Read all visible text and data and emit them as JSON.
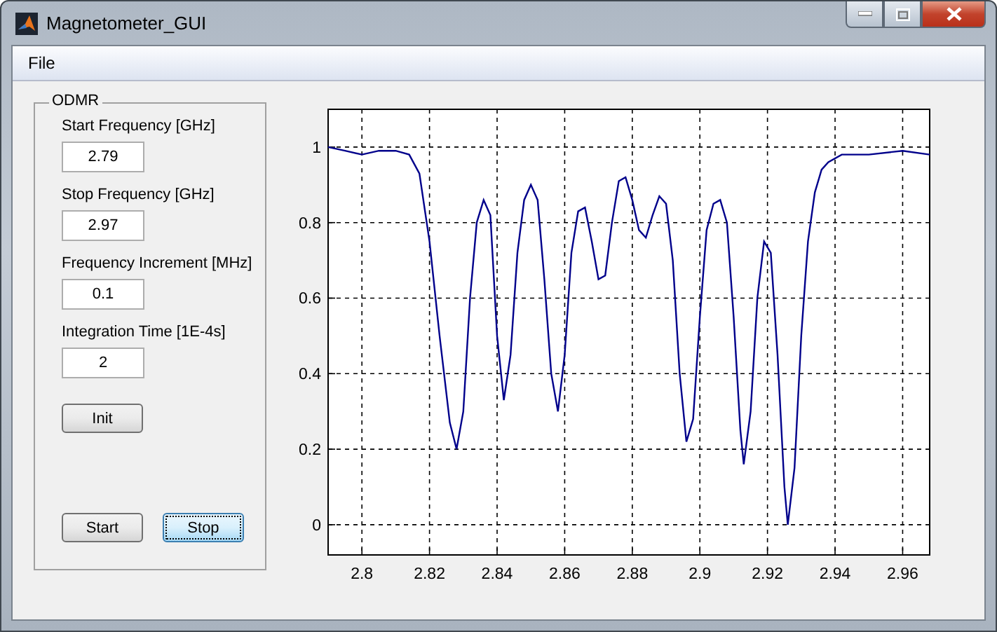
{
  "window": {
    "title": "Magnetometer_GUI"
  },
  "menu": [
    {
      "label": "File"
    }
  ],
  "panel": {
    "title": "ODMR",
    "fields": [
      {
        "label": "Start Frequency [GHz]",
        "value": "2.79"
      },
      {
        "label": "Stop Frequency [GHz]",
        "value": "2.97"
      },
      {
        "label": "Frequency Increment [MHz]",
        "value": "0.1"
      },
      {
        "label": "Integration Time [1E-4s]",
        "value": "2"
      }
    ],
    "init_button": {
      "label": "Init",
      "focused": false
    },
    "run_buttons": [
      {
        "label": "Start",
        "focused": false
      },
      {
        "label": "Stop",
        "focused": true
      }
    ]
  },
  "chart_data": {
    "type": "line",
    "x": [
      2.79,
      2.795,
      2.8,
      2.805,
      2.81,
      2.814,
      2.817,
      2.82,
      2.823,
      2.826,
      2.828,
      2.83,
      2.832,
      2.834,
      2.836,
      2.838,
      2.84,
      2.842,
      2.844,
      2.846,
      2.848,
      2.85,
      2.852,
      2.854,
      2.856,
      2.858,
      2.86,
      2.862,
      2.864,
      2.866,
      2.868,
      2.87,
      2.872,
      2.874,
      2.876,
      2.878,
      2.88,
      2.882,
      2.884,
      2.886,
      2.888,
      2.89,
      2.892,
      2.894,
      2.896,
      2.898,
      2.9,
      2.902,
      2.904,
      2.906,
      2.908,
      2.91,
      2.912,
      2.913,
      2.915,
      2.917,
      2.919,
      2.921,
      2.923,
      2.925,
      2.926,
      2.928,
      2.93,
      2.932,
      2.934,
      2.936,
      2.938,
      2.942,
      2.95,
      2.96,
      2.968
    ],
    "series": [
      {
        "color": "#00008b",
        "values": [
          1.0,
          0.99,
          0.98,
          0.99,
          0.99,
          0.98,
          0.93,
          0.75,
          0.5,
          0.27,
          0.2,
          0.3,
          0.6,
          0.8,
          0.86,
          0.82,
          0.5,
          0.33,
          0.45,
          0.72,
          0.86,
          0.9,
          0.86,
          0.65,
          0.4,
          0.3,
          0.45,
          0.72,
          0.83,
          0.84,
          0.75,
          0.65,
          0.66,
          0.8,
          0.91,
          0.92,
          0.86,
          0.78,
          0.76,
          0.82,
          0.87,
          0.85,
          0.7,
          0.4,
          0.22,
          0.28,
          0.55,
          0.78,
          0.85,
          0.86,
          0.8,
          0.55,
          0.25,
          0.16,
          0.3,
          0.6,
          0.75,
          0.72,
          0.45,
          0.1,
          0.0,
          0.15,
          0.5,
          0.75,
          0.88,
          0.94,
          0.96,
          0.98,
          0.98,
          0.99,
          0.98
        ]
      }
    ],
    "xlim": [
      2.79,
      2.968
    ],
    "ylim": [
      -0.08,
      1.1
    ],
    "xticks": [
      2.8,
      2.82,
      2.84,
      2.86,
      2.88,
      2.9,
      2.92,
      2.94,
      2.96
    ],
    "yticks": [
      0,
      0.2,
      0.4,
      0.6,
      0.8,
      1
    ],
    "grid": true
  }
}
